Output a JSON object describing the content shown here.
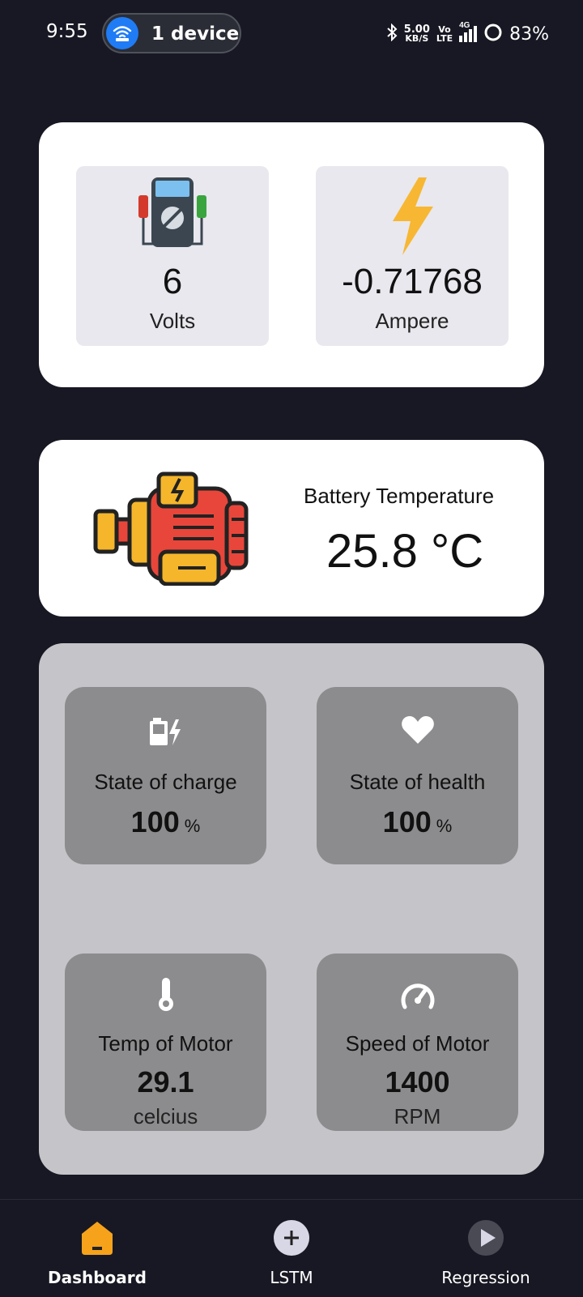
{
  "status_bar": {
    "time": "9:55",
    "device_pill": "1 device",
    "net_speed_value": "5.00",
    "net_speed_unit": "KB/S",
    "volte_top": "Vo",
    "volte_bottom": "LTE",
    "network": "4G",
    "battery_percent": "83%"
  },
  "power_card": {
    "voltage": {
      "value": "6",
      "unit": "Volts",
      "icon": "multimeter-icon"
    },
    "current": {
      "value": "-0.71768",
      "unit": "Ampere",
      "icon": "lightning-icon"
    }
  },
  "battery_temp_card": {
    "title": "Battery Temperature",
    "value": "25.8 °C",
    "icon": "electric-motor-icon"
  },
  "stats": {
    "soc": {
      "title": "State of charge",
      "value": "100",
      "unit": "%",
      "icon": "battery-charging-icon"
    },
    "soh": {
      "title": "State of health",
      "value": "100",
      "unit": "%",
      "icon": "heart-icon"
    },
    "motor_temp": {
      "title": "Temp of Motor",
      "value": "29.1",
      "unit": "celcius",
      "icon": "thermometer-icon"
    },
    "motor_speed": {
      "title": "Speed of Motor",
      "value": "1400",
      "unit": "RPM",
      "icon": "speedometer-icon"
    }
  },
  "nav": {
    "items": [
      {
        "label": "Dashboard",
        "icon": "home-icon",
        "active": true
      },
      {
        "label": "LSTM",
        "icon": "add-icon",
        "active": false
      },
      {
        "label": "Regression",
        "icon": "play-icon",
        "active": false
      }
    ]
  },
  "colors": {
    "background": "#171823",
    "card": "#ffffff",
    "tile": "#e8e8ee",
    "stats_panel": "#c5c5c9",
    "stat_tile": "#8c8c8e",
    "accent_active": "#f7a21b",
    "wifi_badge": "#1f7cf5"
  }
}
